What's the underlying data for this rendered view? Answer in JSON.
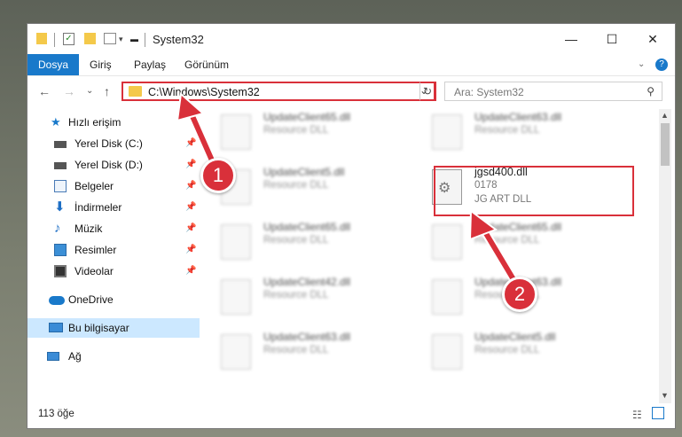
{
  "window": {
    "title": "System32"
  },
  "ribbon": {
    "tabs": [
      "Dosya",
      "Giriş",
      "Paylaş",
      "Görünüm"
    ]
  },
  "address": {
    "path": "C:\\Windows\\System32"
  },
  "search": {
    "placeholder": "Ara: System32"
  },
  "sidebar": {
    "quick_access": "Hızlı erişim",
    "items": [
      {
        "label": "Yerel Disk (C:)",
        "icon": "drive-icon"
      },
      {
        "label": "Yerel Disk (D:)",
        "icon": "drive-icon"
      },
      {
        "label": "Belgeler",
        "icon": "documents-icon"
      },
      {
        "label": "İndirmeler",
        "icon": "downloads-icon"
      },
      {
        "label": "Müzik",
        "icon": "music-icon"
      },
      {
        "label": "Resimler",
        "icon": "pictures-icon"
      },
      {
        "label": "Videolar",
        "icon": "videos-icon"
      }
    ],
    "onedrive": "OneDrive",
    "this_pc": "Bu bilgisayar",
    "network": "Ağ"
  },
  "files": [
    {
      "name": "UpdateClient65.dll",
      "desc": "Resource DLL"
    },
    {
      "name": "UpdateClient63.dll",
      "desc": "Resource DLL"
    },
    {
      "name": "UpdateClient5.dll",
      "desc": "Resource DLL"
    },
    {
      "name": "jgsd400.dll",
      "line2": "0178",
      "desc": "JG ART DLL"
    },
    {
      "name": "UpdateClient65.dll",
      "desc": "Resource DLL"
    },
    {
      "name": "UpdateClient65.dll",
      "desc": "Resource DLL"
    },
    {
      "name": "UpdateClient42.dll",
      "desc": "Resource DLL"
    },
    {
      "name": "UpdateClient63.dll",
      "desc": "Resource DLL"
    },
    {
      "name": "UpdateClient63.dll",
      "desc": "Resource DLL"
    },
    {
      "name": "UpdateClient5.dll",
      "desc": "Resource DLL"
    }
  ],
  "status": {
    "count": "113 öğe"
  },
  "annotations": {
    "badge1": "1",
    "badge2": "2"
  },
  "colors": {
    "accent": "#1979ca",
    "highlight": "#d9303a",
    "folder": "#f4c94a"
  }
}
